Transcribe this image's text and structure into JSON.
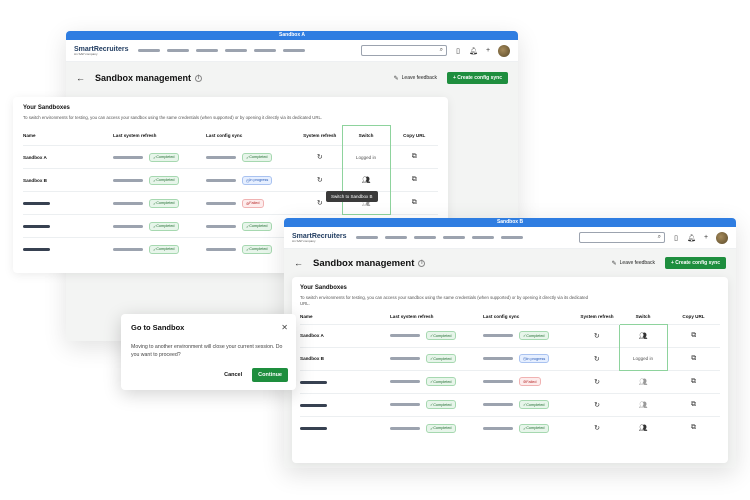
{
  "windowA": {
    "title": "Sandbox A",
    "logo_main": "SmartRecruiters",
    "logo_sub": "An SAP company",
    "page_title": "Sandbox management",
    "feedback": "Leave feedback",
    "create_btn": "+ Create config sync"
  },
  "windowB": {
    "title": "Sandbox B",
    "logo_main": "SmartRecruiters",
    "logo_sub": "An SAP company",
    "page_title": "Sandbox management",
    "feedback": "Leave feedback",
    "create_btn": "+ Create config sync"
  },
  "sandboxesA": {
    "title": "Your Sandboxes",
    "desc": "To switch environments for testing, you can access your sandbox using the same credentials (when supported) or by opening it directly via its dedicated URL.",
    "headers": [
      "Name",
      "Last system refresh",
      "Last config sync",
      "System refresh",
      "Switch",
      "Copy URL"
    ],
    "rows": [
      {
        "name": "Sandbox A",
        "refresh": "Completed",
        "sync": "Completed",
        "sync_status": "ok",
        "switch": "Logged in"
      },
      {
        "name": "Sandbox B",
        "refresh": "Completed",
        "sync": "In progress",
        "sync_status": "prog",
        "switch": ""
      },
      {
        "name": "",
        "refresh": "Completed",
        "sync": "Failed",
        "sync_status": "fail",
        "switch": ""
      },
      {
        "name": "",
        "refresh": "Completed",
        "sync": "Completed",
        "sync_status": "ok",
        "switch": ""
      },
      {
        "name": "",
        "refresh": "Completed",
        "sync": "Completed",
        "sync_status": "ok",
        "switch": ""
      }
    ],
    "tooltip": "Switch to Sandbox B"
  },
  "sandboxesB": {
    "title": "Your Sandboxes",
    "desc": "To switch environments for testing, you can access your sandbox using the same credentials (when supported) or by opening it directly via its dedicated URL.",
    "headers": [
      "Name",
      "Last system refresh",
      "Last config sync",
      "System refresh",
      "Switch",
      "Copy URL"
    ],
    "rows": [
      {
        "name": "Sandbox A",
        "refresh": "Completed",
        "sync": "Completed",
        "sync_status": "ok",
        "switch": ""
      },
      {
        "name": "Sandbox B",
        "refresh": "Completed",
        "sync": "In progress",
        "sync_status": "prog",
        "switch": "Logged in"
      },
      {
        "name": "",
        "refresh": "Completed",
        "sync": "Failed",
        "sync_status": "fail",
        "switch": ""
      },
      {
        "name": "",
        "refresh": "Completed",
        "sync": "Completed",
        "sync_status": "ok",
        "switch": ""
      },
      {
        "name": "",
        "refresh": "Completed",
        "sync": "Completed",
        "sync_status": "ok",
        "switch": ""
      }
    ]
  },
  "dialog": {
    "title": "Go to Sandbox",
    "body": "Moving to another environment will close your current session. Do you want to proceed?",
    "cancel": "Cancel",
    "continue": "Continue"
  },
  "colors": {
    "accent": "#2f7de1",
    "primary": "#1e8e3e"
  }
}
